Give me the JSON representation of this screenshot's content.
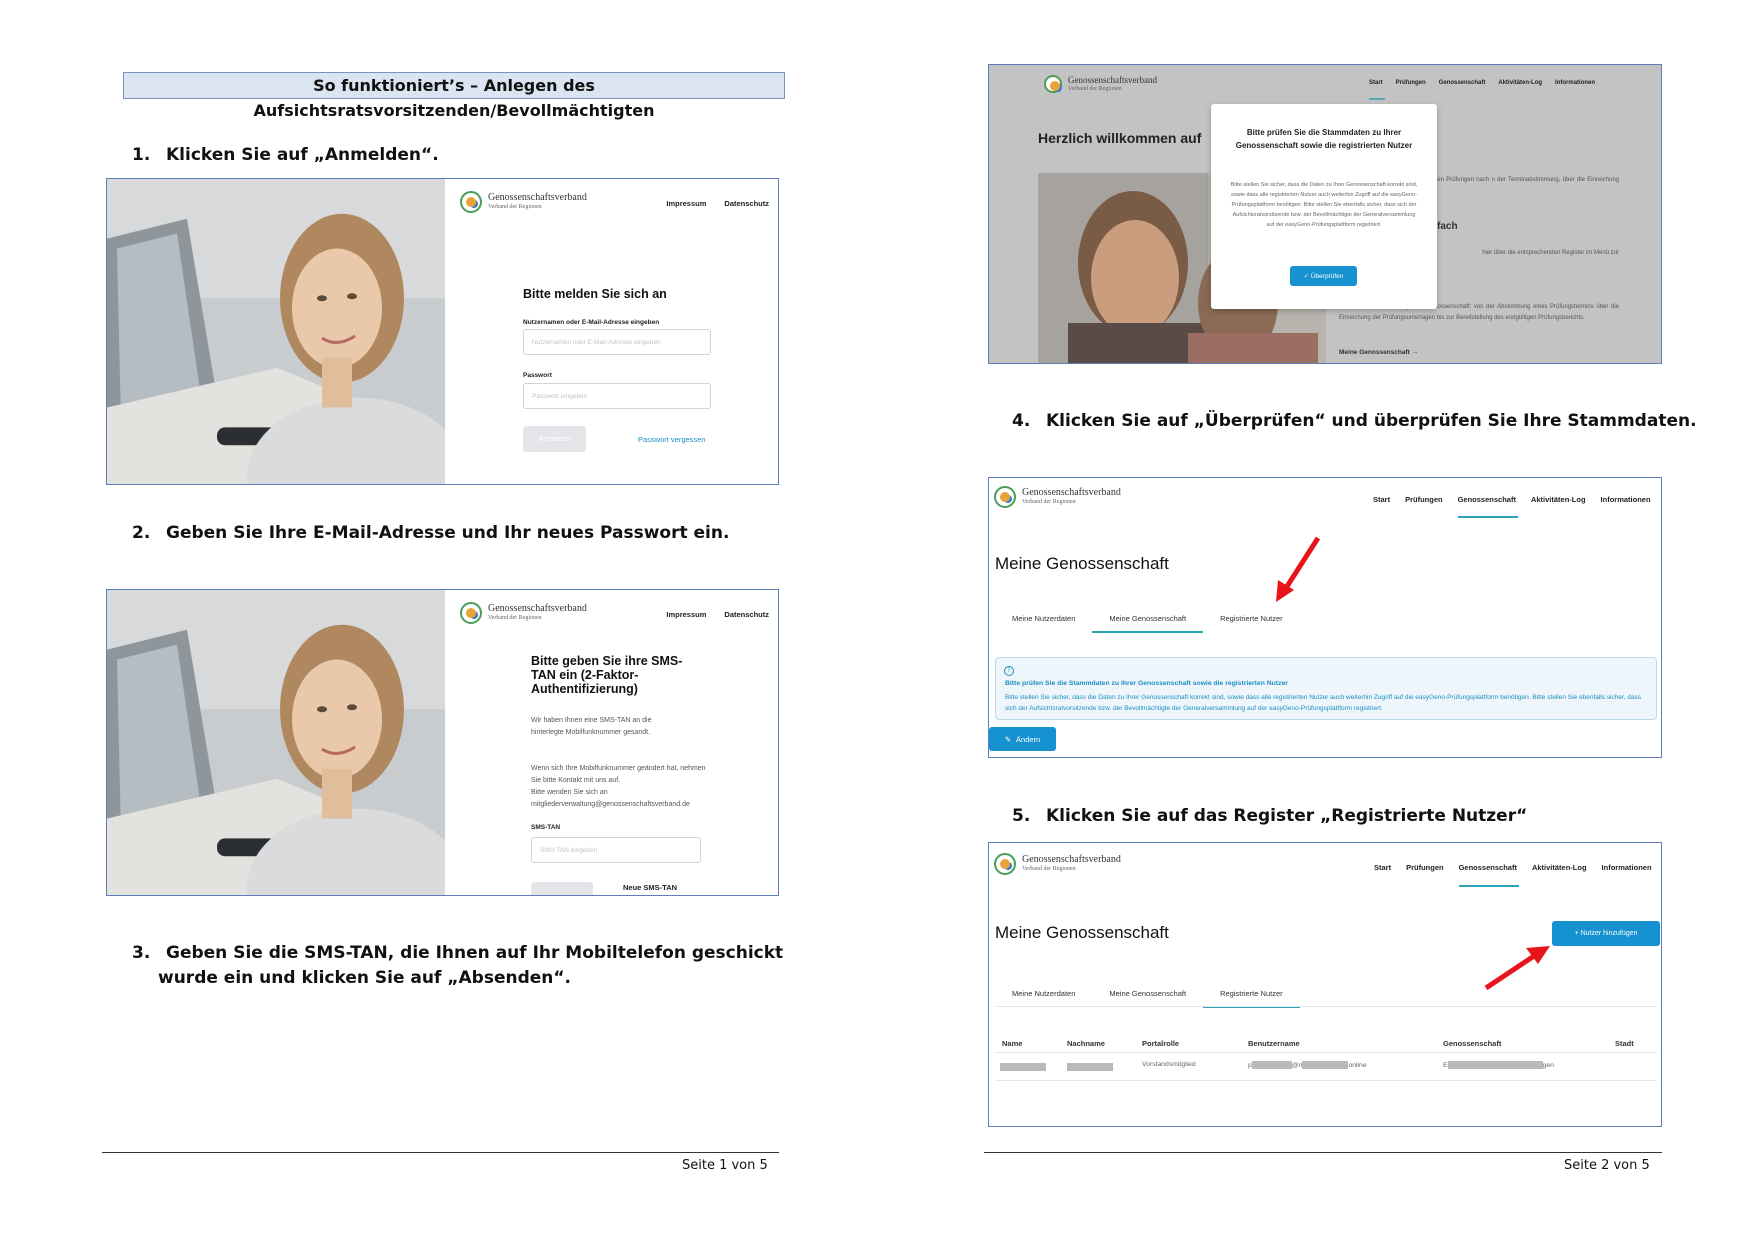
{
  "page_title": "So funktioniert’s – Anlegen des Aufsichtsratsvorsitzenden/Bevollmächtigten",
  "steps": [
    {
      "num": "1.",
      "text": "Klicken Sie auf „Anmelden“."
    },
    {
      "num": "2.",
      "text": "Geben Sie Ihre E-Mail-Adresse und Ihr neues Passwort ein."
    },
    {
      "num": "3.",
      "text": "Geben Sie die SMS-TAN, die Ihnen auf Ihr Mobiltelefon geschickt",
      "text2": "wurde ein und klicken Sie auf „Absenden“."
    },
    {
      "num": "4.",
      "text": "Klicken Sie auf „Überprüfen“ und überprüfen Sie Ihre Stammdaten."
    },
    {
      "num": "5.",
      "text": "Klicken Sie auf das Register „Registrierte Nutzer“"
    }
  ],
  "brand": {
    "name": "Genossenschaftsverband",
    "sub": "Verband der Regionen",
    "accent": "#1a8fc1"
  },
  "login": {
    "nav": [
      "Impressum",
      "Datenschutz"
    ],
    "heading": "Bitte melden Sie sich an",
    "user_label": "Nutzernamen oder E-Mail-Adresse eingeben",
    "user_placeholder": "Nutzernamen oder E-Mail-Adresse eingeben",
    "pw_label": "Passwort",
    "pw_placeholder": "Passwort eingeben",
    "submit": "Anmelden",
    "forgot": "Passwort vergessen"
  },
  "sms": {
    "nav": [
      "Impressum",
      "Datenschutz"
    ],
    "heading": "Bitte geben Sie ihre SMS-TAN ein (2-Faktor-Authentifizierung)",
    "p1": "Wir haben Ihnen eine SMS-TAN an die hinterlegte Mobilfunknummer gesandt.",
    "p2a": "Wenn sich Ihre Mobilfunknummer geändert hat, nehmen Sie bitte Kontakt mit uns auf.",
    "p2b": "Bitte wenden Sie sich an",
    "p2c": "mitgliederverwaltung@genossenschaftsverband.de",
    "tan_label": "SMS-TAN",
    "tan_placeholder": "SMS-TAN eingeben",
    "resend": "Neue SMS-TAN"
  },
  "portal_nav": [
    "Start",
    "Prüfungen",
    "Genossenschaft",
    "Aktivitäten-Log",
    "Informationen"
  ],
  "modal_shot": {
    "welcome": "Herzlich willkommen auf",
    "modal_title": "Bitte prüfen Sie die Stammdaten zu Ihrer Genossenschaft sowie die registrierten Nutzer",
    "modal_body": "Bitte stellen Sie sicher, dass die Daten zu Ihrer Genossenschaft korrekt sind, sowie dass alle registrierten Nutzer auch weiterhin Zugriff auf die easyGeno-Prüfungsplattform benötigen. Bitte stellen Sie ebenfalls sicher, dass sich der Aufsichtsratvorsitzende bzw. der Bevollmächtigte der Generalversammlung auf der easyGeno-Prüfungsplattform registriert.",
    "modal_button": "✓ Überprüfen",
    "bg_text1": "tform organisieren wir die gesetzlichen Prüfungen nach n der Terminabstimmung, über die Einreichung der ittlung des Prüfungsberichts.",
    "bg_head2": "fach",
    "bg_text2": "hier über die entsprechenden Register im Menü zur",
    "bg_text3": "über die aktuelle Prüfung Ihrer Genossenschaft: von der Abstimmung eines Prüfungstermins über die Einreichung der Prüfungsunterlagen bis zur Bereitstellung des endgültigen Prüfungsberichts.",
    "bg_link": "Meine Genossenschaft →"
  },
  "geno_shot": {
    "title": "Meine Genossenschaft",
    "tabs": [
      "Meine Nutzerdaten",
      "Meine Genossenschaft",
      "Registrierte Nutzer"
    ],
    "alert_title": "Bitte prüfen Sie die Stammdaten zu Ihrer Genossenschaft sowie die registrierten Nutzer",
    "alert_text": "Bitte stellen Sie sicher, dass die Daten zu Ihrer Genossenschaft korrekt sind, sowie dass alle registrierten Nutzer auch weiterhin Zugriff auf die easyGeno-Prüfungsplattform benötigen. Bitte stellen Sie ebenfalls sicher, dass sich der Aufsichtsratvorsitzende bzw. der Bevollmächtigte der Generalversammlung auf der easyGeno-Prüfungsplattform registriert.",
    "edit_button": "Ändern"
  },
  "users_shot": {
    "title": "Meine Genossenschaft",
    "add_button": "+ Nutzer hinzufügen",
    "tabs": [
      "Meine Nutzerdaten",
      "Meine Genossenschaft",
      "Registrierte Nutzer"
    ],
    "columns": [
      "Name",
      "Nachname",
      "Portalrolle",
      "Benutzername",
      "Genossenschaft",
      "Stadt"
    ],
    "row": {
      "role": "Vorstandsmitglied",
      "user_a": "p",
      "user_b": "@n",
      "user_c": "online",
      "geno_a": "E",
      "geno_b": "gen"
    }
  },
  "footers": [
    "Seite 1 von 5",
    "Seite 2 von 5"
  ],
  "colors": {
    "arrow": "#e8141b",
    "tab_underline": "#2aa2b8",
    "button": "#1592cf"
  }
}
